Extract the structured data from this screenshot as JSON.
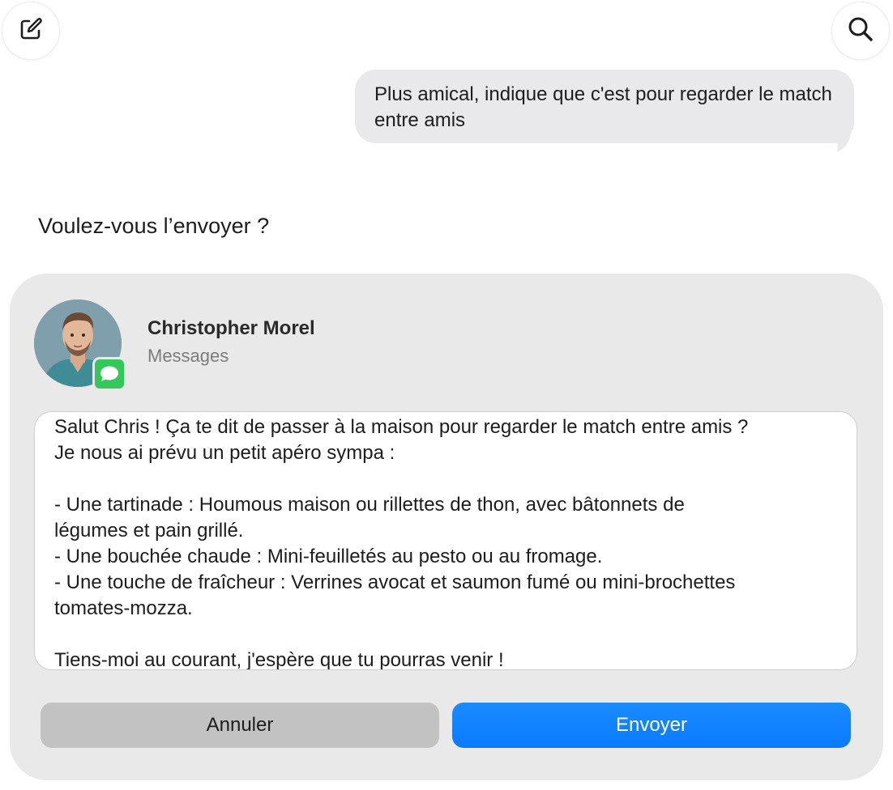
{
  "toolbar": {
    "compose_icon": "square-and-pencil",
    "search_icon": "magnifying-glass"
  },
  "conversation": {
    "user_message": "Plus amical, indique que c'est pour regarder le match entre amis"
  },
  "prompt": {
    "question": "Voulez-vous l’envoyer ?"
  },
  "card": {
    "contact_name": "Christopher Morel",
    "app_name": "Messages",
    "message_lines": [
      "Salut Chris ! Ça te dit de passer à la maison pour regarder le match entre amis ?",
      "Je nous ai prévu un petit apéro sympa :",
      "",
      "- Une tartinade : Houmous maison ou rillettes de thon, avec bâtonnets de",
      "légumes et pain grillé.",
      "- Une bouchée chaude : Mini-feuilletés au pesto ou au fromage.",
      "- Une touche de fraîcheur : Verrines avocat et saumon fumé ou mini-brochettes",
      "tomates-mozza.",
      "",
      "Tiens-moi au courant, j'espère que tu pourras venir !"
    ],
    "cancel_label": "Annuler",
    "send_label": "Envoyer"
  },
  "colors": {
    "accent_blue": "#0a7aff",
    "bubble_gray": "#e9e9eb",
    "card_gray": "#e9e9e9",
    "cancel_gray": "#c2c2c2",
    "messages_green": "#34c759"
  }
}
